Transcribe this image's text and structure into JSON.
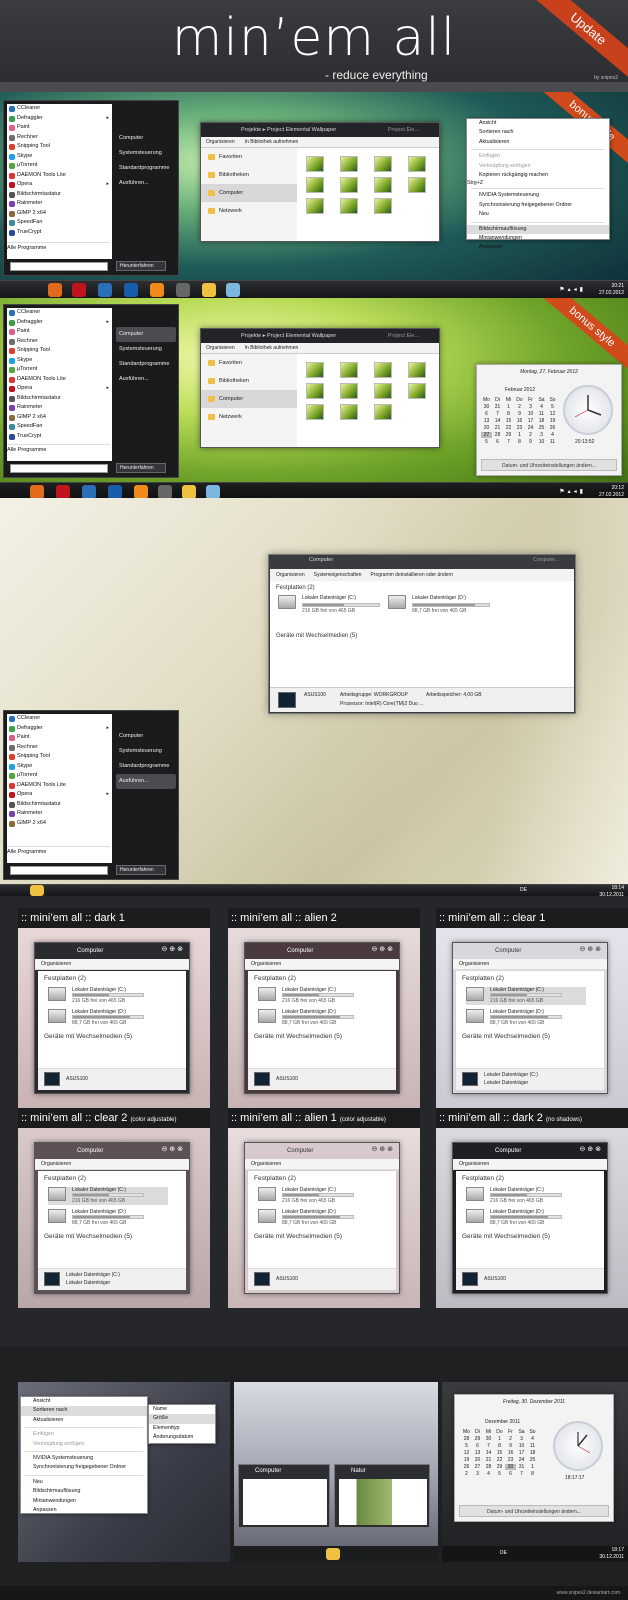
{
  "header": {
    "title": "min’em all",
    "subtitle": "- reduce everything",
    "byline": "by snipes2",
    "ribbon": "Update"
  },
  "bonus": "bonus style",
  "start_menu": {
    "items1": [
      "CCleaner",
      "Defraggler",
      "Paint",
      "Rechner",
      "Snipping Tool",
      "Skype",
      "µTorrent",
      "DAEMON Tools Lite",
      "Opera",
      "Bildschirmtastatur",
      "Rainmeter",
      "GIMP 2 x64",
      "SpeedFan",
      "TrueCrypt"
    ],
    "items3": [
      "CCleaner",
      "Defraggler",
      "Paint",
      "Rechner",
      "Snipping Tool",
      "Skype",
      "µTorrent",
      "DAEMON Tools Lite",
      "Opera",
      "Bildschirmtastatur",
      "Rainmeter",
      "GIMP 2 x64"
    ],
    "all": "Alle Programme",
    "right": [
      "Computer",
      "Systemsteuerung",
      "Standardprogramme",
      "Ausführen..."
    ],
    "shutdown": "Herunterfahren"
  },
  "explorer": {
    "crumb1": "Projekte",
    "crumb2": "Project Elemental Wallpaper",
    "search": "Project Ele...",
    "organize": "Organisieren",
    "library": "In Bibliothek aufnehmen",
    "nav": [
      "Favoriten",
      "Bibliotheken",
      "Computer",
      "Netzwerk"
    ]
  },
  "context_menu": {
    "items": [
      "Ansicht",
      "Sortieren nach",
      "Aktualisieren",
      "Einfügen",
      "Verknüpfung einfügen",
      "Kopieren rückgängig machen",
      "NVIDIA Systemsteuerung",
      "Synchronisierung freigegebener Ordner",
      "Neu",
      "Bildschirmauflösung",
      "Minianwendungen",
      "Anpassen"
    ],
    "shortcut": "Strg+Z"
  },
  "tray1": {
    "time": "20:21",
    "date": "27.02.2012"
  },
  "tray2": {
    "time": "20:12",
    "date": "27.02.2012"
  },
  "tray3": {
    "lang": "DE",
    "time": "18:14",
    "date": "30.12.2011"
  },
  "calendar1": {
    "date": "Montag, 27. Februar 2012",
    "month": "Februar 2012",
    "weekdays": [
      "Mo",
      "Di",
      "Mi",
      "Do",
      "Fr",
      "Sa",
      "So"
    ],
    "days": [
      "30",
      "31",
      "1",
      "2",
      "3",
      "4",
      "5",
      "6",
      "7",
      "8",
      "9",
      "10",
      "11",
      "12",
      "13",
      "14",
      "15",
      "16",
      "17",
      "18",
      "19",
      "20",
      "21",
      "22",
      "23",
      "24",
      "25",
      "26",
      "27",
      "28",
      "29",
      "1",
      "2",
      "3",
      "4",
      "5",
      "6",
      "7",
      "8",
      "9",
      "10",
      "11"
    ],
    "time": "20:13:52",
    "change": "Datum- und Uhrzeiteinstellungen ändern..."
  },
  "computer": {
    "title": "Computer",
    "search": "Computer...",
    "tools": [
      "Organisieren",
      "Systemeigenschaften",
      "Programm deinstallieren oder ändern"
    ],
    "group1": "Festplatten (2)",
    "group2": "Geräte mit Wechselmedien (5)",
    "drive_c": "Lokaler Datenträger (C:)",
    "drive_c_free": "216 GB frei von 465 GB",
    "drive_d": "Lokaler Datenträger (D:)",
    "drive_d_free": "88,7 GB frei von 465 GB",
    "pc": "ASUS100",
    "workgroup": "Arbeitsgruppe: WORKGROUP",
    "memory": "Arbeitsspeicher: 4,00 GB",
    "cpu": "Prozessor: Intel(R) Core(TM)2 Duo ..."
  },
  "showcase": [
    {
      "title": ":: mini’em all :: dark 1",
      "note": ""
    },
    {
      "title": ":: mini’em all :: alien 2",
      "note": ""
    },
    {
      "title": ":: mini’em all :: clear 1",
      "note": ""
    },
    {
      "title": ":: mini’em all :: clear 2",
      "note": "(color adjustable)"
    },
    {
      "title": ":: mini’em all :: alien 1",
      "note": "(color adjustable)"
    },
    {
      "title": ":: mini’em all :: dark 2",
      "note": "(no shadows)"
    }
  ],
  "mini": {
    "title": "Computer",
    "organize": "Organisieren",
    "group1": "Festplatten (2)",
    "c": "Lokaler Datenträger (C:)",
    "c_free": "216 GB frei von 465 GB",
    "d": "Lokaler Datenträger (D:)",
    "d_free": "88,7 GB frei von 465 GB",
    "group2": "Geräte mit Wechselmedien (5)",
    "pc": "ASUS100",
    "removable1": "Lokaler Datenträger (C:)",
    "removable2": "Lokaler Datenträger"
  },
  "bottom": {
    "ctx": [
      "Ansicht",
      "Sortieren nach",
      "Aktualisieren",
      "Einfügen",
      "Verknüpfung einfügen",
      "NVIDIA Systemsteuerung",
      "Synchronisierung freigegebener Ordner",
      "Neu",
      "Bildschirmauflösung",
      "Minianwendungen",
      "Anpassen"
    ],
    "sub": [
      "Name",
      "Größe",
      "Elementtyp",
      "Änderungsdatum"
    ],
    "thumb1": "Computer",
    "thumb2": "Natur",
    "cal_date": "Freitag, 30. Dezember 2011",
    "cal_month": "Dezember 2011",
    "cal_days": [
      "28",
      "29",
      "30",
      "1",
      "2",
      "3",
      "4",
      "5",
      "6",
      "7",
      "8",
      "9",
      "10",
      "11",
      "12",
      "13",
      "14",
      "15",
      "16",
      "17",
      "18",
      "19",
      "20",
      "21",
      "22",
      "23",
      "24",
      "25",
      "26",
      "27",
      "28",
      "29",
      "30",
      "31",
      "1",
      "2",
      "3",
      "4",
      "5",
      "6",
      "7",
      "8"
    ],
    "cal_time": "18:17:17",
    "cal_change": "Datum- und Uhrzeiteinstellungen ändern...",
    "lang": "DE",
    "time": "18:17",
    "date": "30.12.2011"
  },
  "footer": "www.snipes2.deviantart.com"
}
